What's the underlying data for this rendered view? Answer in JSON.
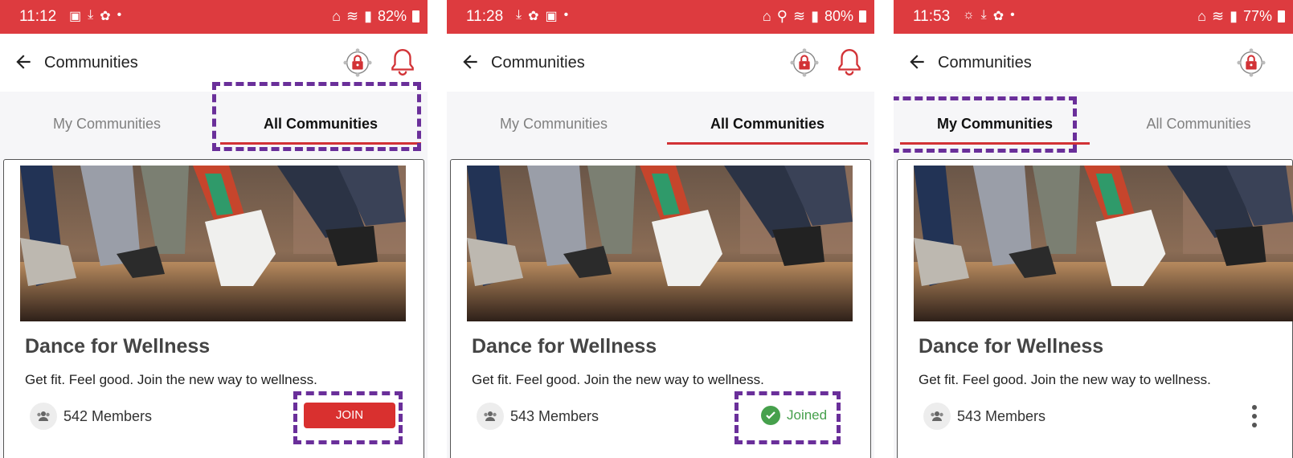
{
  "colors": {
    "brand_red": "#dd3b3f",
    "highlight_purple": "#6a2f9a",
    "joined_green": "#46a04c"
  },
  "screens": [
    {
      "status": {
        "time": "11:12",
        "battery": "82%"
      },
      "header": {
        "title": "Communities"
      },
      "tabs": {
        "my": "My Communities",
        "all": "All Communities",
        "active": "all"
      },
      "card": {
        "title": "Dance for Wellness",
        "description": "Get fit. Feel good. Join the new way to wellness.",
        "members": "542 Members",
        "action": "JOIN"
      }
    },
    {
      "status": {
        "time": "11:28",
        "battery": "80%"
      },
      "header": {
        "title": "Communities"
      },
      "tabs": {
        "my": "My Communities",
        "all": "All Communities",
        "active": "all"
      },
      "card": {
        "title": "Dance for Wellness",
        "description": "Get fit. Feel good. Join the new way to wellness.",
        "members": "543 Members",
        "action": "Joined"
      }
    },
    {
      "status": {
        "time": "11:53",
        "battery": "77%"
      },
      "header": {
        "title": "Communities"
      },
      "tabs": {
        "my": "My Communities",
        "all": "All Communities",
        "active": "my"
      },
      "card": {
        "title": "Dance for Wellness",
        "description": "Get fit. Feel good. Join the new way to wellness.",
        "members": "543 Members"
      }
    }
  ]
}
